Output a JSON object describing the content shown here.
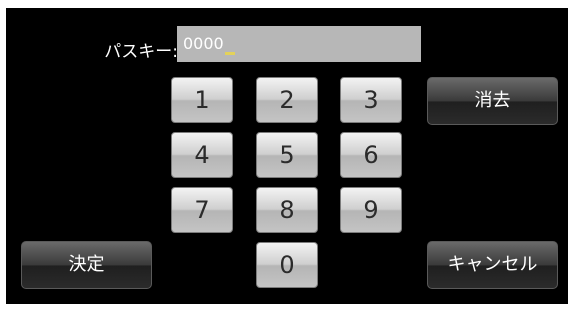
{
  "passkey": {
    "label": "パスキー:",
    "value": "0000"
  },
  "keypad": {
    "keys": [
      "1",
      "2",
      "3",
      "4",
      "5",
      "6",
      "7",
      "8",
      "9",
      "0"
    ]
  },
  "actions": {
    "clear_label": "消去",
    "confirm_label": "決定",
    "cancel_label": "キャンセル"
  }
}
